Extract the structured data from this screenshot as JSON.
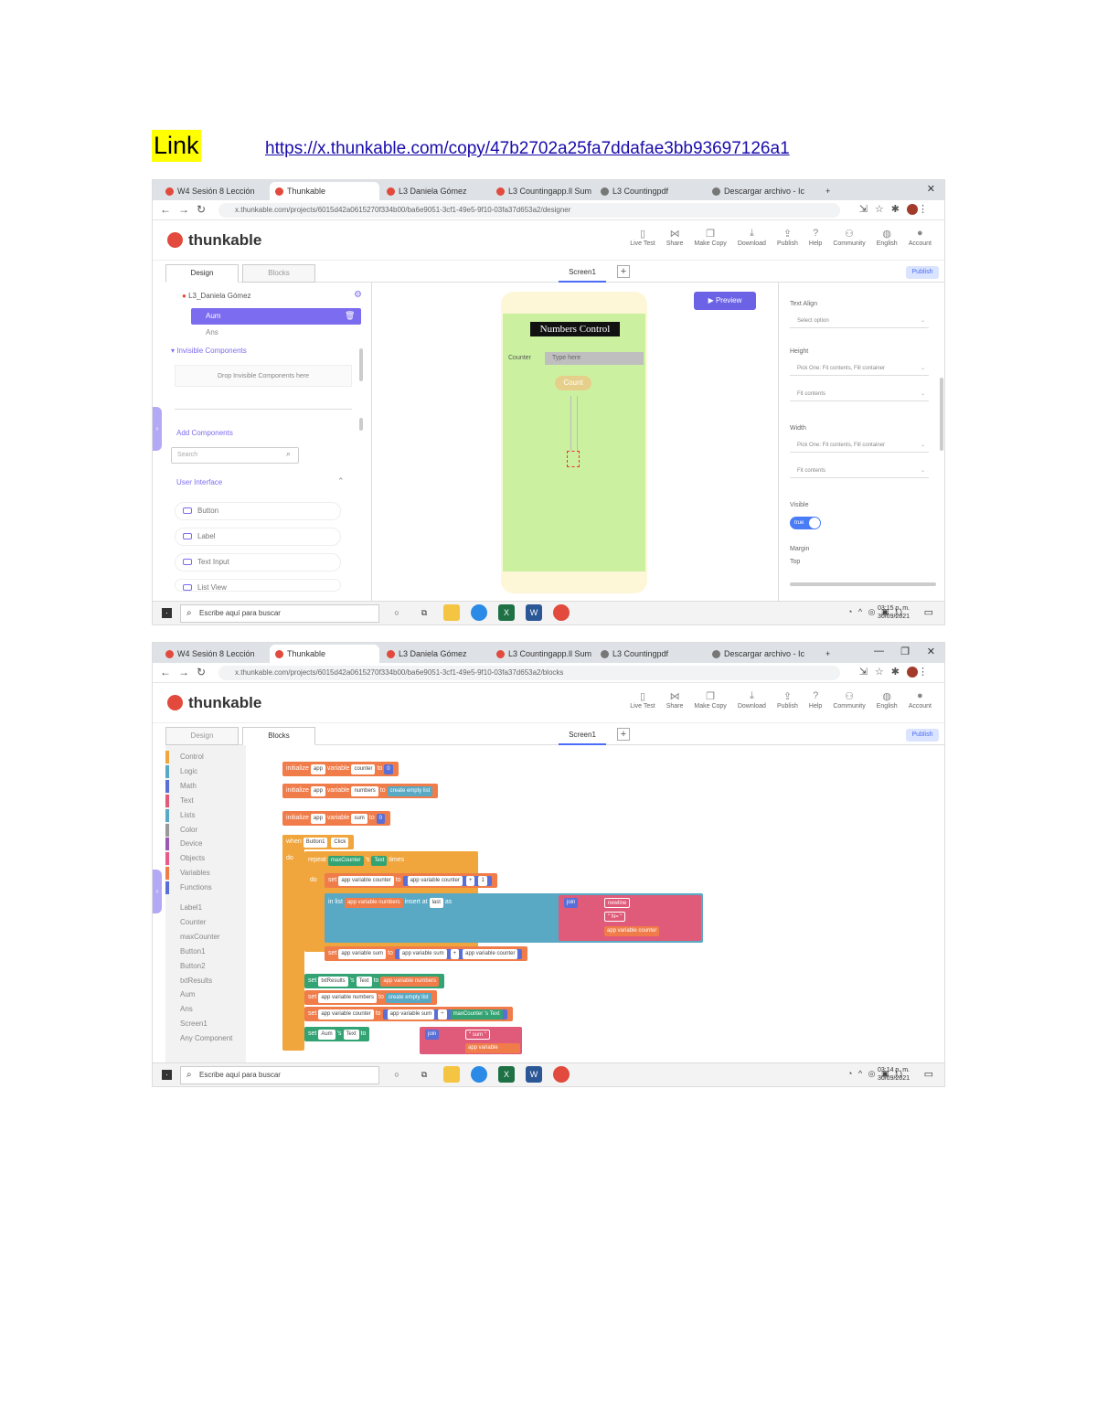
{
  "link": {
    "label": "Link",
    "url": "https://x.thunkable.com/copy/47b2702a25fa7ddafae3bb93697126a1"
  },
  "browser": {
    "tabs": [
      "W4 Sesión 8 Lección",
      "Thunkable",
      "L3 Daniela Gómez",
      "L3 Countingapp.ll Sum",
      "L3 Countingpdf",
      "Descargar archivo - Ic"
    ],
    "new_tab": "+",
    "url_design": "x.thunkable.com/projects/6015d42a0615270f334b00/ba6e9051-3cf1-49e5-9f10-03fa37d653a2/designer",
    "url_blocks": "x.thunkable.com/projects/6015d42a0615270f334b00/ba6e9051-3cf1-49e5-9f10-03fa37d653a2/blocks"
  },
  "app": {
    "logo": "thunkable",
    "tools": [
      "Live Test",
      "Share",
      "Make Copy",
      "Download",
      "Publish",
      "Help",
      "Community",
      "English",
      "Account"
    ],
    "tab_design": "Design",
    "tab_blocks": "Blocks",
    "screen": "Screen1",
    "add": "+",
    "publish": "Publish"
  },
  "design": {
    "project": "L3_Daniela Gómez",
    "selected": "Aum",
    "sub": "Ans",
    "invisible_header": "Invisible Components",
    "drop_text": "Drop Invisible Components here",
    "add_components": "Add Components",
    "search_placeholder": "Search",
    "ui_header": "User Interface",
    "components": [
      "Button",
      "Label",
      "Text Input",
      "List View"
    ],
    "phone_title": "Numbers Control",
    "phone_label": "Counter",
    "phone_input": "Type here",
    "phone_button": "Count",
    "preview": "Preview",
    "props": {
      "text_align_label": "Text Align",
      "text_align_value": "Select option",
      "height_label": "Height",
      "height_value_1": "Pick One: Fit contents, Fill container",
      "height_value_2": "Fit contents",
      "width_label": "Width",
      "width_value_1": "Pick One: Fit contents, Fill container",
      "width_value_2": "Fit contents",
      "visible_label": "Visible",
      "visible_value": "true",
      "margin_label": "Margin",
      "margin_top": "Top"
    }
  },
  "blocks": {
    "palette": [
      "Control",
      "Logic",
      "Math",
      "Text",
      "Lists",
      "Color",
      "Device",
      "Objects",
      "Variables",
      "Functions",
      "Label1",
      "Counter",
      "maxCounter",
      "Button1",
      "Button2",
      "txtResults",
      "Aum",
      "Ans",
      "Screen1",
      "Any Component"
    ],
    "palette_colors": [
      "#f0a63c",
      "#5aa9c4",
      "#5a6fd6",
      "#e05a79",
      "#5aa9c4",
      "#999999",
      "#9b59b6",
      "#e85a8a",
      "#f07c4a",
      "#5a6fd6"
    ],
    "init1": [
      "initialize",
      "app",
      "variable",
      "counter",
      "to",
      "0"
    ],
    "init2": [
      "initialize",
      "app",
      "variable",
      "numbers",
      "to",
      "create empty list"
    ],
    "init3": [
      "initialize",
      "app",
      "variable",
      "sum",
      "to",
      "0"
    ],
    "event": [
      "when",
      "Button1",
      "Click"
    ],
    "do": "do",
    "repeat": [
      "repeat",
      "maxCounter",
      "'s",
      "Text",
      "times"
    ],
    "set_counter": [
      "set",
      "app variable counter",
      "to",
      "app variable counter",
      "+",
      "1"
    ],
    "insert": [
      "in list",
      "app variable numbers",
      "insert at",
      "last",
      "as",
      "join",
      "newline",
      "\" N= \"",
      "app variable counter"
    ],
    "set_sum": [
      "set",
      "app variable sum",
      "to",
      "app variable sum",
      "+",
      "app variable counter"
    ],
    "set_results": [
      "set",
      "txtResults",
      "'s",
      "Text",
      "to",
      "app variable numbers"
    ],
    "set_numbers": [
      "set",
      "app variable numbers",
      "to",
      "create empty list"
    ],
    "set_counter2": [
      "set",
      "app variable counter",
      "to",
      "app variable sum",
      "÷",
      "maxCounter",
      "'s",
      "Text"
    ],
    "set_aum": [
      "set",
      "Aum",
      "'s",
      "Text",
      "to",
      "join",
      "\" sum \"",
      "app variable counter"
    ]
  },
  "taskbar": {
    "search": "Escribe aquí para buscar",
    "time1": "03:15 p. m.",
    "date1": "30/09/2021",
    "time2": "03:14 p. m.",
    "date2": "30/09/2021"
  },
  "colors": {
    "accent": "#7c6cf0",
    "phone_bg": "#cbf1a0",
    "link_highlight": "#ffff00"
  }
}
